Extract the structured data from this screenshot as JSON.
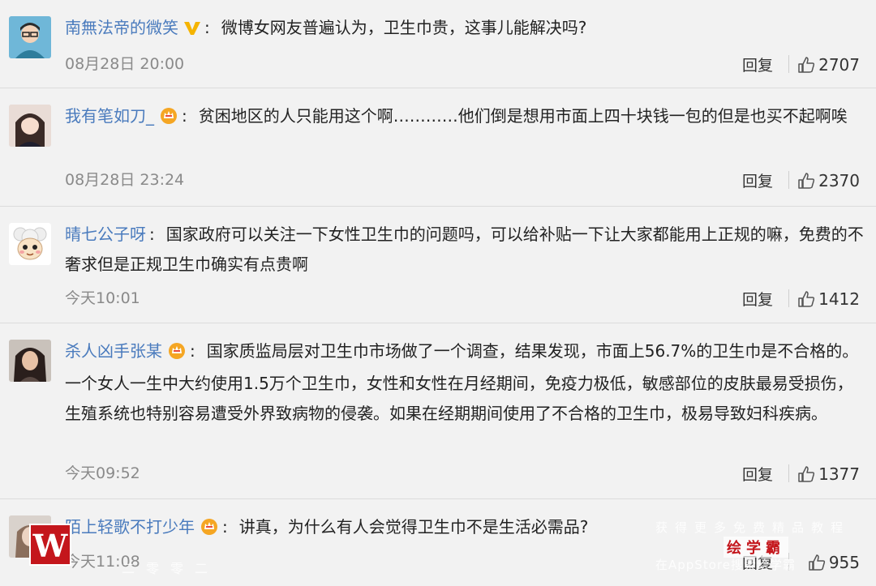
{
  "comments": [
    {
      "name": "南無法帝的微笑",
      "badge": "v",
      "text": "微博女网友普遍认为，卫生巾贵，这事儿能解决吗?",
      "time": "08月28日 20:00",
      "reply": "回复",
      "likes": "2707",
      "avatar": "boy-glasses"
    },
    {
      "name": "我有笔如刀_",
      "badge": "crown",
      "text": "贫困地区的人只能用这个啊…………他们倒是想用市面上四十块钱一包的但是也买不起啊唉",
      "time": "08月28日 23:24",
      "reply": "回复",
      "likes": "2370",
      "avatar": "girl-bangs"
    },
    {
      "name": "晴七公子呀",
      "badge": "",
      "text": "国家政府可以关注一下女性卫生巾的问题吗，可以给补贴一下让大家都能用上正规的嘛，免费的不奢求但是正规卫生巾确实有点贵啊",
      "time": "今天10:01",
      "reply": "回复",
      "likes": "1412",
      "avatar": "sheep-cartoon"
    },
    {
      "name": "杀人凶手张某",
      "badge": "crown",
      "text": "国家质监局层对卫生巾市场做了一个调查，结果发现，市面上56.7%的卫生巾是不合格的。一个女人一生中大约使用1.5万个卫生巾，女性和女性在月经期间，免疫力极低，敏感部位的皮肤最易受损伤，生殖系统也特别容易遭受外界致病物的侵袭。如果在经期期间使用了不合格的卫生巾，极易导致妇科疾病。",
      "time": "今天09:52",
      "reply": "回复",
      "likes": "1377",
      "avatar": "woman-dark-hair"
    },
    {
      "name": "陌上轻歌不打少年",
      "badge": "crown",
      "text": "讲真，为什么有人会觉得卫生巾不是生活必需品?",
      "time": "今天11:08",
      "reply": "回复",
      "likes": "955",
      "avatar": "woman-light"
    }
  ],
  "watermark": {
    "logo": "W",
    "right_top": "获得更多免费精品教程",
    "brand": "绘学霸",
    "right_bottom": "在AppStore搜索绘学霸",
    "left_sub": "二零零二"
  },
  "colors": {
    "name": "#4a7bbd",
    "text": "#222222",
    "time": "#8a8a8a",
    "background": "#f2f2f2"
  }
}
